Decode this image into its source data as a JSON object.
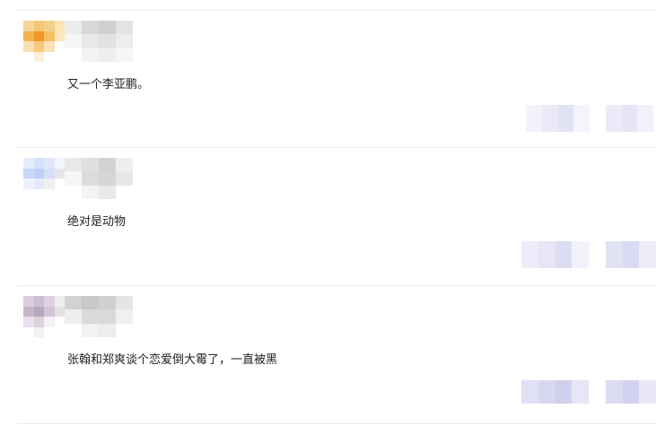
{
  "comments": [
    {
      "text": "又一个李亚鹏。",
      "avatar_colors": [
        "#f6d59a",
        "#f7c674",
        "#f2d08a",
        "#fbe3b4",
        "#f4b44c",
        "#f0962a",
        "#f5c060",
        "#fde6c0",
        "#fae0b0",
        "#f6c97a",
        "#fbe2b6",
        "#ffffff",
        "#ffffff",
        "#fcefd8",
        "#ffffff",
        "#ffffff"
      ],
      "name_colors": [
        "#ececec",
        "#d7d7d7",
        "#cfcfcf",
        "#e4e4e4",
        "#f5f5f5",
        "#e8e8e8",
        "#e2e2e2",
        "#ededed",
        "#ffffff",
        "#f3f3f3",
        "#eeeeee",
        "#f6f6f6"
      ],
      "action_colors": [
        "#f2f2fb",
        "#e9e9f8",
        "#e2e2f5",
        "#f4f4fc",
        "#ffffff",
        "#eaeaf8",
        "#e5e5f6",
        "#f1f1fb"
      ]
    },
    {
      "text": "绝对是动物",
      "avatar_colors": [
        "#e4ecfb",
        "#d5e1fa",
        "#dfe7f8",
        "#f1f4fd",
        "#c9d8f8",
        "#bfd0f6",
        "#d4dff9",
        "#e6e6e6",
        "#edf2fd",
        "#e3eafb",
        "#f0f0f0",
        "#ffffff",
        "#ffffff",
        "#ffffff",
        "#ffffff",
        "#ffffff"
      ],
      "name_colors": [
        "#e9e9e9",
        "#e0e0e0",
        "#d2d2d2",
        "#efefef",
        "#f6f6f6",
        "#dcdcdc",
        "#d6d6d6",
        "#e7e7e7",
        "#ffffff",
        "#f4f4f4",
        "#e9e9e9",
        "#ffffff"
      ],
      "action_colors": [
        "#ededfa",
        "#e6e6f7",
        "#dcdcf3",
        "#f2f2fb",
        "#ffffff",
        "#e2e2f5",
        "#dadaf3",
        "#ececf9"
      ]
    },
    {
      "text": "张翰和郑爽谈个恋爱倒大霉了，一直被黑",
      "avatar_colors": [
        "#d9cddd",
        "#cdbfd3",
        "#ddd3e0",
        "#eeeeee",
        "#c6b6cc",
        "#b9a7c1",
        "#d2c6d6",
        "#e1e1e1",
        "#e9e1eb",
        "#dcd0df",
        "#f2f2f2",
        "#ffffff",
        "#ffffff",
        "#f5f0f6",
        "#ffffff",
        "#ffffff"
      ],
      "name_colors": [
        "#d2d2d2",
        "#c9c9c9",
        "#d0d0d0",
        "#e5e5e5",
        "#eeeeee",
        "#dadada",
        "#d9d9d9",
        "#f0f0f0",
        "#ffffff",
        "#f2f2f2",
        "#ededed",
        "#ffffff"
      ],
      "action_colors": [
        "#e1e1f5",
        "#d8d8f2",
        "#cfcfef",
        "#e6e6f6",
        "#ffffff",
        "#dcdcf3",
        "#d2d2f0",
        "#e8e8f8"
      ]
    }
  ]
}
